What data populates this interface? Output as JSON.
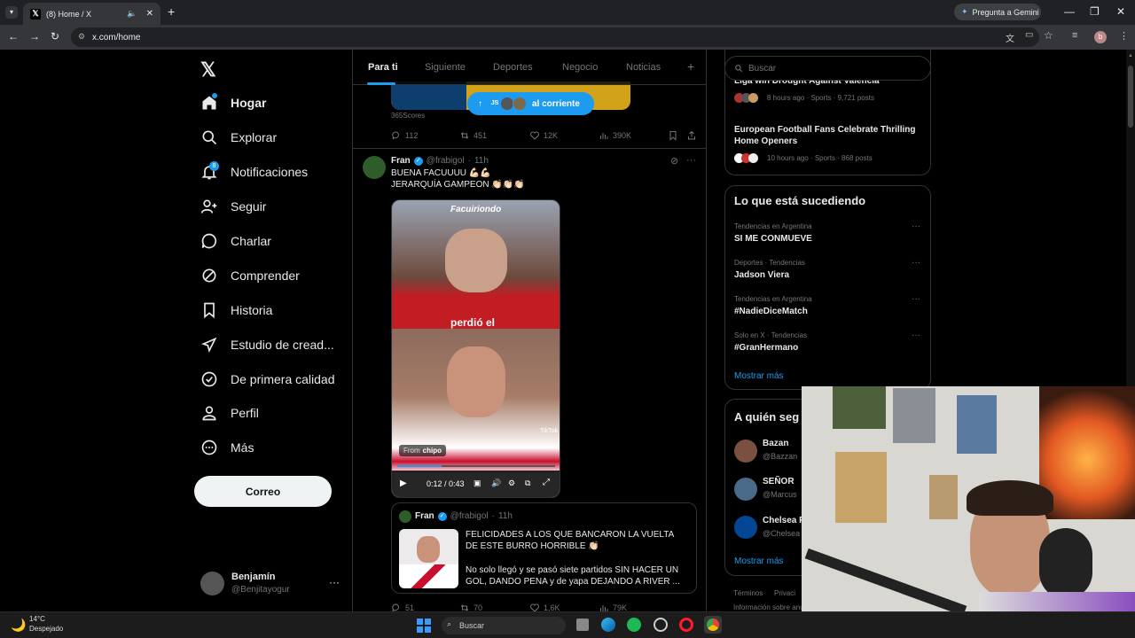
{
  "browser": {
    "tab_title": "(8) Home / X",
    "url": "x.com/home",
    "gemini_label": "Pregunta a Gemini",
    "profile_initial": "b"
  },
  "nav": {
    "items": [
      {
        "label": "Hogar",
        "icon": "home-icon"
      },
      {
        "label": "Explorar",
        "icon": "search-icon"
      },
      {
        "label": "Notificaciones",
        "icon": "bell-icon",
        "badge": "8"
      },
      {
        "label": "Seguir",
        "icon": "follow-icon"
      },
      {
        "label": "Charlar",
        "icon": "chat-icon"
      },
      {
        "label": "Comprender",
        "icon": "grok-icon"
      },
      {
        "label": "Historia",
        "icon": "bookmark-icon"
      },
      {
        "label": "Estudio de cread...",
        "icon": "rocket-icon"
      },
      {
        "label": "De primera calidad",
        "icon": "verified-icon"
      },
      {
        "label": "Perfil",
        "icon": "profile-icon"
      },
      {
        "label": "Más",
        "icon": "more-icon"
      }
    ],
    "post_button": "Correo",
    "account": {
      "name": "Benjamín",
      "handle": "@Benjitayogur"
    }
  },
  "feed": {
    "tabs": [
      "Para ti",
      "Siguiente",
      "Deportes",
      "Negocio",
      "Noticias"
    ],
    "new_posts_pill": "al corriente",
    "pill_avatar_text": "JS",
    "prev_post": {
      "source": "365Scores",
      "stats": {
        "replies": "112",
        "reposts": "451",
        "likes": "12K",
        "views": "390K"
      }
    },
    "post": {
      "name": "Fran",
      "handle": "@frabigol",
      "time": "11h",
      "line1": "BUENA FACUUUU 💪🏻💪🏻",
      "line2": "JERARQUÍA GAMPEON 👏🏻👏🏻👏🏻",
      "video_overlay_top": "Facuiriondo",
      "video_overlay_mid": "perdió el",
      "video_time": "0:12 / 0:43",
      "video_from": "From",
      "video_from_user": "chipo",
      "video_watermark": "TikTok"
    },
    "quote": {
      "name": "Fran",
      "handle": "@frabigol",
      "time": "11h",
      "text1": "FELICIDADES A LOS QUE BANCARON LA VUELTA DE ESTE BURRO HORRIBLE 👏🏻",
      "text2": "No solo llegó y se pasó siete partidos SIN HACER UN GOL, DANDO PENA y de yapa DEJANDO A RIVER ..."
    },
    "next_stats": {
      "replies": "51",
      "reposts": "70",
      "likes": "1,6K",
      "views": "79K"
    }
  },
  "right": {
    "search_placeholder": "Buscar",
    "news": [
      {
        "title": "Liga win Drought Against Valencia",
        "meta": "8 hours ago · Sports · 9,721 posts"
      },
      {
        "title": "European Football Fans Celebrate Thrilling Home Openers",
        "meta": "10 hours ago · Sports · 868 posts"
      }
    ],
    "trends_title": "Lo que está sucediendo",
    "trends": [
      {
        "context": "Tendencias en Argentina",
        "name": "SI ME CONMUEVE"
      },
      {
        "context": "Deportes · Tendencias",
        "name": "Jadson Viera"
      },
      {
        "context": "Tendencias en Argentina",
        "name": "#NadieDiceMatch"
      },
      {
        "context": "Solo en X · Tendencias",
        "name": "#GranHermano"
      }
    ],
    "show_more": "Mostrar más",
    "who_title": "A quién seg",
    "who": [
      {
        "name": "Bazan",
        "handle": "@Bazzan"
      },
      {
        "name": "SEÑOR",
        "handle": "@Marcus"
      },
      {
        "name": "Chelsea F",
        "handle": "@Chelsea"
      }
    ],
    "show_more2": "Mostrar más",
    "footer1": "Términos",
    "footer2": "Privaci",
    "footer3": "Información sobre anu"
  },
  "taskbar": {
    "temp": "14°C",
    "weather": "Despejado",
    "search": "Buscar"
  },
  "colors": {
    "accent": "#1d9bf0",
    "bg": "#000000",
    "border": "#2f3336",
    "muted": "#71767b"
  }
}
